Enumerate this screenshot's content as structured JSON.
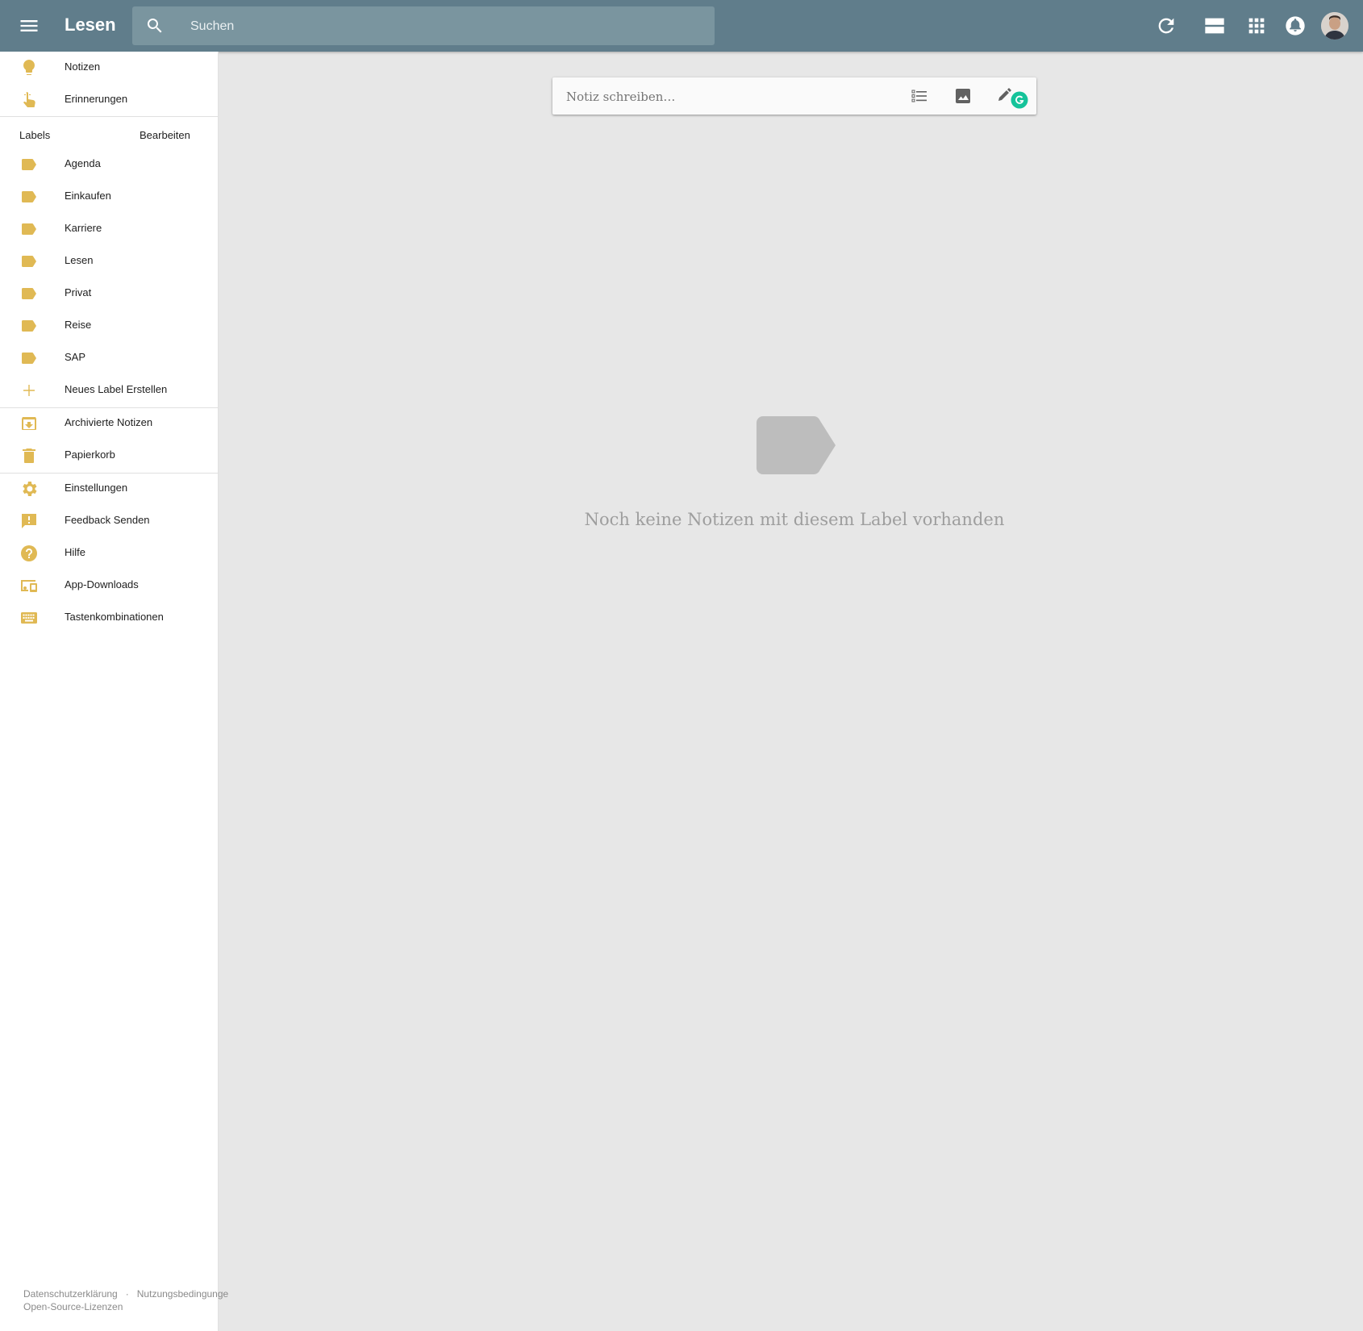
{
  "header": {
    "title": "Lesen",
    "search_placeholder": "Suchen",
    "icons": [
      "menu-icon",
      "search-icon",
      "refresh-icon",
      "list-view-icon",
      "apps-icon",
      "notifications-icon",
      "avatar"
    ]
  },
  "sidebar": {
    "top_items": [
      {
        "label": "Notizen",
        "icon": "lightbulb-icon"
      },
      {
        "label": "Erinnerungen",
        "icon": "reminder-hand-icon"
      }
    ],
    "labels_header": "Labels",
    "labels_edit": "Bearbeiten",
    "labels": [
      {
        "label": "Agenda",
        "icon": "label-icon"
      },
      {
        "label": "Einkaufen",
        "icon": "label-icon"
      },
      {
        "label": "Karriere",
        "icon": "label-icon"
      },
      {
        "label": "Lesen",
        "icon": "label-icon"
      },
      {
        "label": "Privat",
        "icon": "label-icon"
      },
      {
        "label": "Reise",
        "icon": "label-icon"
      },
      {
        "label": "SAP",
        "icon": "label-icon"
      }
    ],
    "new_label": "Neues Label Erstellen",
    "archive_items": [
      {
        "label": "Archivierte Notizen",
        "icon": "archive-icon"
      },
      {
        "label": "Papierkorb",
        "icon": "trash-icon"
      }
    ],
    "settings_items": [
      {
        "label": "Einstellungen",
        "icon": "gear-icon"
      },
      {
        "label": "Feedback Senden",
        "icon": "feedback-icon"
      },
      {
        "label": "Hilfe",
        "icon": "help-icon"
      },
      {
        "label": "App-Downloads",
        "icon": "devices-icon"
      },
      {
        "label": "Tastenkombinationen",
        "icon": "keyboard-icon"
      }
    ],
    "footer": {
      "privacy": "Datenschutzerklärung",
      "separator": "·",
      "terms": "Nutzungsbedingunge",
      "oss": "Open-Source-Lizenzen"
    }
  },
  "composer": {
    "placeholder": "Notiz schreiben…"
  },
  "empty_state": {
    "message": "Noch keine Notizen mit diesem Label vorhanden"
  },
  "colors": {
    "header_bg": "#607d8b",
    "search_bg": "#7a959f",
    "sidebar_icon": "#e0b954",
    "main_bg": "#e7e7e7",
    "grammarly": "#15c39a"
  }
}
